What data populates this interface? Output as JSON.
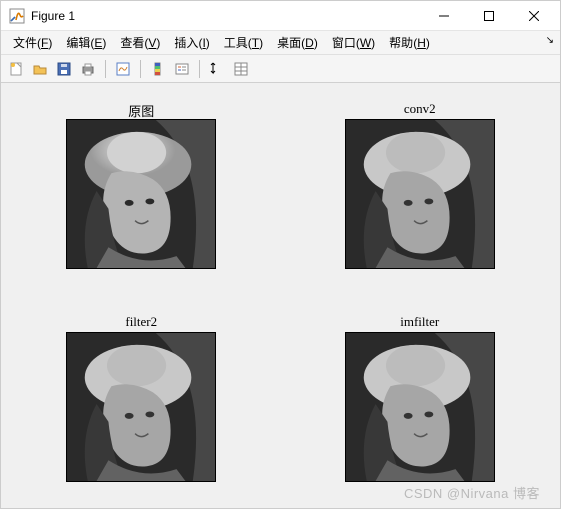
{
  "window": {
    "title": "Figure 1"
  },
  "menu": {
    "items": [
      {
        "label": "文件",
        "hotkey": "F"
      },
      {
        "label": "编辑",
        "hotkey": "E"
      },
      {
        "label": "查看",
        "hotkey": "V"
      },
      {
        "label": "插入",
        "hotkey": "I"
      },
      {
        "label": "工具",
        "hotkey": "T"
      },
      {
        "label": "桌面",
        "hotkey": "D"
      },
      {
        "label": "窗口",
        "hotkey": "W"
      },
      {
        "label": "帮助",
        "hotkey": "H"
      }
    ]
  },
  "toolbar": {
    "icons": [
      "new-figure",
      "open",
      "save",
      "print",
      "sep",
      "linked-axes",
      "sep",
      "insert-colorbar",
      "insert-legend",
      "sep",
      "edit-plot",
      "open-property-inspector"
    ]
  },
  "subplots": [
    {
      "title": "原图"
    },
    {
      "title": "conv2"
    },
    {
      "title": "filter2"
    },
    {
      "title": "imfilter"
    }
  ],
  "watermark": "CSDN @Nirvana 博客"
}
